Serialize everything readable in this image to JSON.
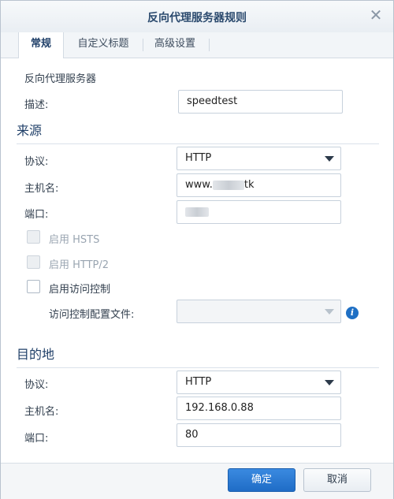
{
  "dialog": {
    "title": "反向代理服务器规则",
    "close_icon": "close-icon"
  },
  "tabs": [
    {
      "label": "常规",
      "active": true
    },
    {
      "label": "自定义标题",
      "active": false
    },
    {
      "label": "高级设置",
      "active": false
    }
  ],
  "general": {
    "heading": "反向代理服务器",
    "description_label": "描述:",
    "description_value": "speedtest"
  },
  "source": {
    "heading": "来源",
    "protocol_label": "协议:",
    "protocol_value": "HTTP",
    "hostname_label": "主机名:",
    "hostname_prefix": "www.",
    "hostname_suffix": "tk",
    "port_label": "端口:",
    "hsts_label": "启用 HSTS",
    "http2_label": "启用 HTTP/2",
    "access_control_label": "启用访问控制",
    "access_profile_label": "访问控制配置文件:",
    "access_profile_value": ""
  },
  "destination": {
    "heading": "目的地",
    "protocol_label": "协议:",
    "protocol_value": "HTTP",
    "hostname_label": "主机名:",
    "hostname_value": "192.168.0.88",
    "port_label": "端口:",
    "port_value": "80"
  },
  "footer": {
    "ok_label": "确定",
    "cancel_label": "取消"
  },
  "colors": {
    "accent": "#1f6cc6",
    "heading": "#1f3f68"
  }
}
